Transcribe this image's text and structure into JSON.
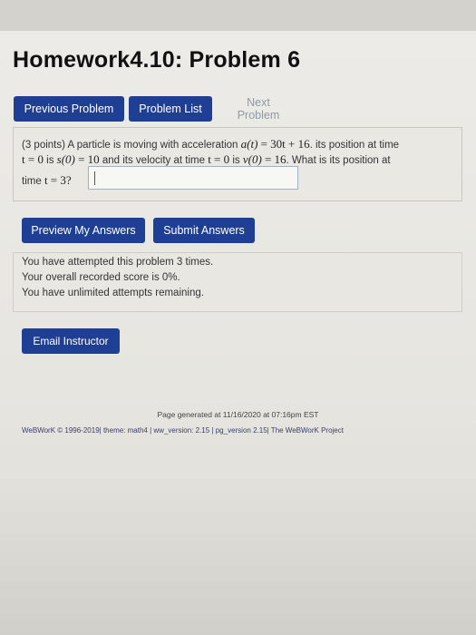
{
  "page": {
    "title": "Homework4.10: Problem 6"
  },
  "nav": {
    "previous_label": "Previous Problem",
    "list_label": "Problem List",
    "next_label": "Next Problem"
  },
  "problem": {
    "points": "(3 points)",
    "t1": "A particle is moving with acceleration",
    "accel_lhs": "a(t)",
    "accel_rhs": "30t + 16",
    "t2": ". its position at time",
    "t_eq0_a": "t = 0",
    "t3": "is",
    "pos_lhs": "s(0)",
    "pos_rhs": "10",
    "t4": "and its velocity at time",
    "t_eq0_b": "t = 0",
    "t5": "is",
    "vel_lhs": "v(0)",
    "vel_rhs": "16",
    "t6": ". What is its position at",
    "t7": "time",
    "t_eq3": "t = 3",
    "qmark": "?"
  },
  "answer": {
    "value": ""
  },
  "actions": {
    "preview_label": "Preview My Answers",
    "submit_label": "Submit Answers"
  },
  "status": {
    "attempts": "You have attempted this problem 3 times.",
    "score": "Your overall recorded score is 0%.",
    "remaining": "You have unlimited attempts remaining."
  },
  "email": {
    "label": "Email Instructor"
  },
  "footer": {
    "generated": "Page generated at 11/16/2020 at 07:16pm EST",
    "credits": "WeBWorK © 1996-2019| theme: math4 | ww_version: 2.15 | pg_version 2.15| The WeBWorK Project"
  },
  "colors": {
    "button_blue": "#1f3f94",
    "disabled_text": "#8e9aa8"
  }
}
